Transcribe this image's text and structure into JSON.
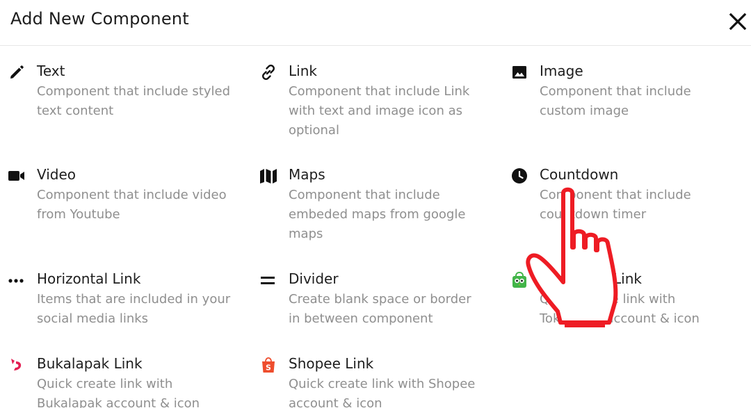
{
  "header": {
    "title": "Add New Component"
  },
  "components": [
    {
      "name": "text",
      "icon": "pencil-icon",
      "title": "Text",
      "desc": "Component that include styled text content"
    },
    {
      "name": "link",
      "icon": "chain-link-icon",
      "title": "Link",
      "desc": "Component that include Link with text and image icon as optional"
    },
    {
      "name": "image",
      "icon": "image-icon",
      "title": "Image",
      "desc": "Component that include custom image"
    },
    {
      "name": "video",
      "icon": "video-camera-icon",
      "title": "Video",
      "desc": "Component that include video from Youtube"
    },
    {
      "name": "maps",
      "icon": "map-icon",
      "title": "Maps",
      "desc": "Component that include embeded maps from google maps"
    },
    {
      "name": "countdown",
      "icon": "clock-icon",
      "title": "Countdown",
      "desc": "Component that include countdown timer"
    },
    {
      "name": "horizontal-link",
      "icon": "more-horizontal-icon",
      "title": "Horizontal Link",
      "desc": "Items that are included in your social media links"
    },
    {
      "name": "divider",
      "icon": "equals-icon",
      "title": "Divider",
      "desc": "Create blank space or border in between component"
    },
    {
      "name": "tokopedia-link",
      "icon": "tokopedia-logo-icon",
      "title": "Tokopedia Link",
      "desc": "Quick create link with Tokopedia account & icon"
    },
    {
      "name": "bukalapak-link",
      "icon": "bukalapak-logo-icon",
      "title": "Bukalapak Link",
      "desc": "Quick create link with Bukalapak account & icon"
    },
    {
      "name": "shopee-link",
      "icon": "shopee-logo-icon",
      "title": "Shopee Link",
      "desc": "Quick create link with Shopee account & icon"
    }
  ],
  "overlay": {
    "icon": "hand-pointer-icon"
  }
}
